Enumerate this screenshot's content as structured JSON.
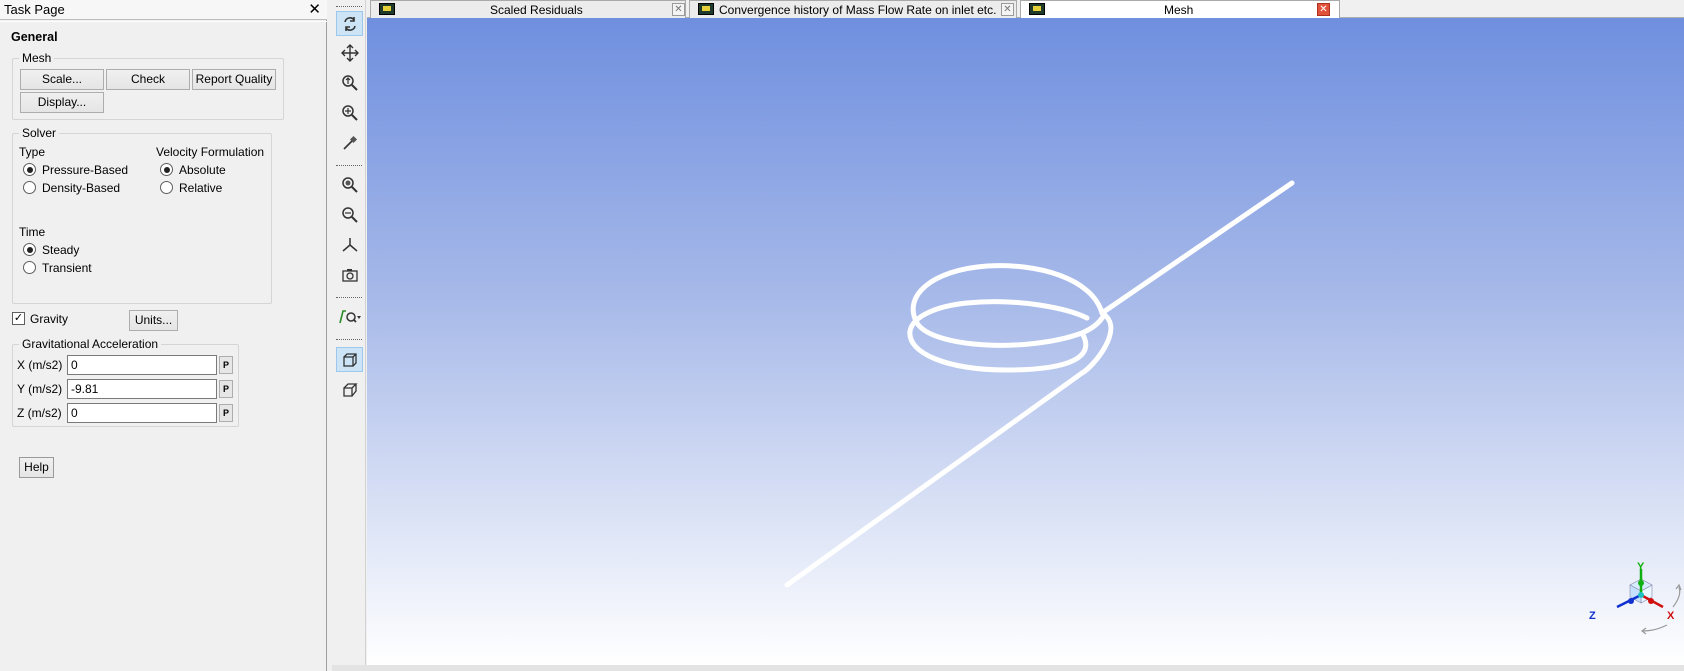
{
  "task_page": {
    "title": "Task Page",
    "close_glyph": "✕",
    "heading": "General",
    "mesh": {
      "legend": "Mesh",
      "scale": "Scale...",
      "check": "Check",
      "report_quality": "Report Quality",
      "display": "Display..."
    },
    "solver": {
      "legend": "Solver",
      "type_label": "Type",
      "type_options": [
        "Pressure-Based",
        "Density-Based"
      ],
      "type_selected": "Pressure-Based",
      "velocity_label": "Velocity Formulation",
      "velocity_options": [
        "Absolute",
        "Relative"
      ],
      "velocity_selected": "Absolute",
      "time_label": "Time",
      "time_options": [
        "Steady",
        "Transient"
      ],
      "time_selected": "Steady"
    },
    "gravity": {
      "label": "Gravity",
      "checked": true,
      "check_glyph": "✓",
      "units_button": "Units..."
    },
    "grav_accel": {
      "legend": "Gravitational Acceleration",
      "x_label": "X (m/s2)",
      "x_value": "0",
      "y_label": "Y (m/s2)",
      "y_value": "-9.81",
      "z_label": "Z (m/s2)",
      "z_value": "0",
      "p_label": "P"
    },
    "help": "Help"
  },
  "toolbar": {
    "icons": [
      "rotate-icon",
      "pan-icon",
      "zoom-icon",
      "zoom-in-icon",
      "probe-icon",
      "zoom-to-fit-icon",
      "zoom-out-icon",
      "axes-icon",
      "snapshot-icon",
      "view-options-icon",
      "orthographic-view-icon",
      "perspective-view-icon"
    ]
  },
  "tabs": [
    {
      "label": "Scaled Residuals",
      "active": false
    },
    {
      "label": "Convergence history of Mass Flow Rate on inlet etc.",
      "active": false
    },
    {
      "label": "Mesh",
      "active": true
    }
  ],
  "triad": {
    "x": "X",
    "y": "Y",
    "z": "Z"
  },
  "colors": {
    "accent_active": "#cde4f7",
    "bg_top": "#6f8fdf",
    "bg_bottom": "#ffffff",
    "axis_x": "#d01010",
    "axis_y": "#10b010",
    "axis_z": "#1030d0"
  }
}
